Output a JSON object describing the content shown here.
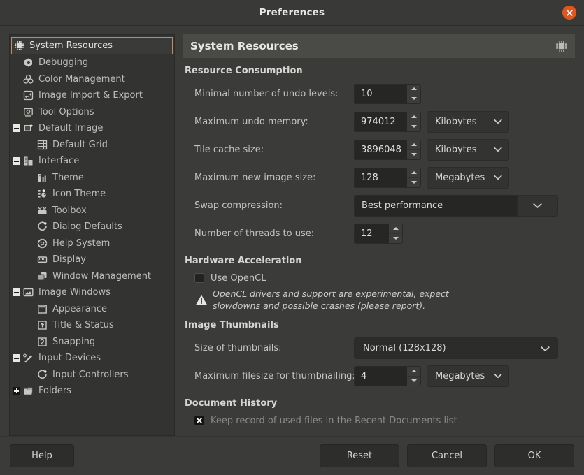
{
  "window": {
    "title": "Preferences",
    "close_icon": "close-icon",
    "accent_color": "#e0561f",
    "selected_border_color": "#c08a62"
  },
  "sidebar": {
    "items": [
      {
        "label": "System Resources",
        "icon": "chip-icon",
        "level": 0,
        "expander": "none",
        "selected": true
      },
      {
        "label": "Debugging",
        "icon": "bug-icon",
        "level": 0,
        "expander": "none",
        "selected": false
      },
      {
        "label": "Color Management",
        "icon": "color-circles-icon",
        "level": 0,
        "expander": "none",
        "selected": false
      },
      {
        "label": "Image Import & Export",
        "icon": "image-exchange-icon",
        "level": 0,
        "expander": "none",
        "selected": false
      },
      {
        "label": "Tool Options",
        "icon": "tool-options-icon",
        "level": 0,
        "expander": "none",
        "selected": false
      },
      {
        "label": "Default Image",
        "icon": "default-image-icon",
        "level": 0,
        "expander": "minus",
        "selected": false
      },
      {
        "label": "Default Grid",
        "icon": "grid-icon",
        "level": 1,
        "expander": "none",
        "selected": false
      },
      {
        "label": "Interface",
        "icon": "interface-icon",
        "level": 0,
        "expander": "minus",
        "selected": false
      },
      {
        "label": "Theme",
        "icon": "theme-icon",
        "level": 1,
        "expander": "none",
        "selected": false
      },
      {
        "label": "Icon Theme",
        "icon": "icon-theme-icon",
        "level": 1,
        "expander": "none",
        "selected": false
      },
      {
        "label": "Toolbox",
        "icon": "toolbox-icon",
        "level": 1,
        "expander": "none",
        "selected": false
      },
      {
        "label": "Dialog Defaults",
        "icon": "dialog-defaults-icon",
        "level": 1,
        "expander": "none",
        "selected": false
      },
      {
        "label": "Help System",
        "icon": "help-system-icon",
        "level": 1,
        "expander": "none",
        "selected": false
      },
      {
        "label": "Display",
        "icon": "display-icon",
        "level": 1,
        "expander": "none",
        "selected": false
      },
      {
        "label": "Window Management",
        "icon": "window-management-icon",
        "level": 1,
        "expander": "none",
        "selected": false
      },
      {
        "label": "Image Windows",
        "icon": "image-windows-icon",
        "level": 0,
        "expander": "minus",
        "selected": false
      },
      {
        "label": "Appearance",
        "icon": "appearance-icon",
        "level": 1,
        "expander": "none",
        "selected": false
      },
      {
        "label": "Title & Status",
        "icon": "title-status-icon",
        "level": 1,
        "expander": "none",
        "selected": false
      },
      {
        "label": "Snapping",
        "icon": "snapping-icon",
        "level": 1,
        "expander": "none",
        "selected": false
      },
      {
        "label": "Input Devices",
        "icon": "input-devices-icon",
        "level": 0,
        "expander": "minus",
        "selected": false
      },
      {
        "label": "Input Controllers",
        "icon": "input-controllers-icon",
        "level": 1,
        "expander": "none",
        "selected": false
      },
      {
        "label": "Folders",
        "icon": "folders-icon",
        "level": 0,
        "expander": "plus",
        "selected": false
      }
    ]
  },
  "content": {
    "header_title": "System Resources",
    "header_icon": "chip-icon",
    "sections": {
      "resource_consumption": {
        "title": "Resource Consumption",
        "fields": {
          "undo_levels": {
            "label": "Minimal number of undo levels:",
            "value": "10"
          },
          "undo_memory": {
            "label": "Maximum undo memory:",
            "value": "974012",
            "unit": "Kilobytes"
          },
          "tile_cache": {
            "label": "Tile cache size:",
            "value": "3896048",
            "unit": "Kilobytes"
          },
          "max_image_size": {
            "label": "Maximum new image size:",
            "value": "128",
            "unit": "Megabytes"
          },
          "swap_compression": {
            "label": "Swap compression:",
            "value": "Best performance"
          },
          "threads": {
            "label": "Number of threads to use:",
            "value": "12"
          }
        }
      },
      "hardware_acceleration": {
        "title": "Hardware Acceleration",
        "use_opencl": {
          "label": "Use OpenCL",
          "checked": false
        },
        "warning": {
          "icon": "warning-triangle-icon",
          "text": "OpenCL drivers and support are experimental, expect slowdowns and possible crashes (please report)."
        }
      },
      "image_thumbnails": {
        "title": "Image Thumbnails",
        "fields": {
          "thumb_size": {
            "label": "Size of thumbnails:",
            "value": "Normal (128x128)"
          },
          "max_filesize": {
            "label": "Maximum filesize for thumbnailing:",
            "value": "4",
            "unit": "Megabytes"
          }
        }
      },
      "document_history": {
        "title": "Document History",
        "keep_record": {
          "label": "Keep record of used files in the Recent Documents list",
          "checked": true
        }
      }
    }
  },
  "footer": {
    "help": "Help",
    "reset": "Reset",
    "cancel": "Cancel",
    "ok": "OK"
  }
}
